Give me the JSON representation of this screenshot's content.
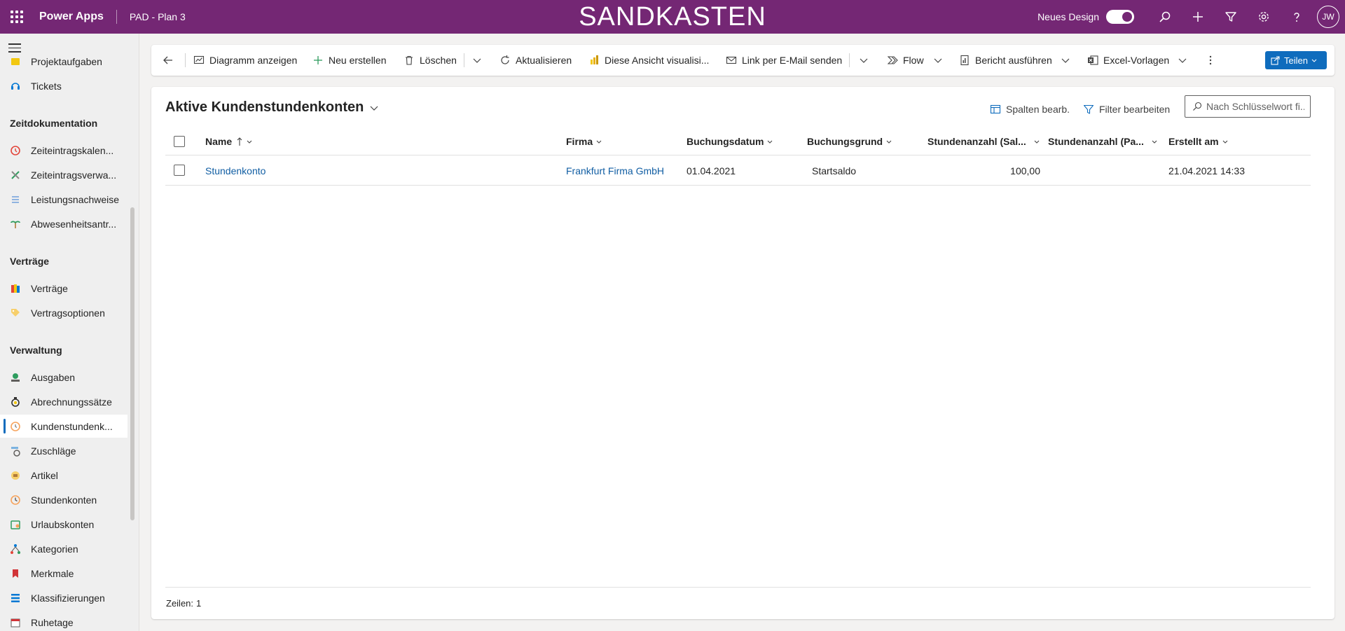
{
  "topbar": {
    "app_name": "Power Apps",
    "environment": "PAD - Plan 3",
    "banner": "SANDKASTEN",
    "new_design_label": "Neues Design",
    "new_design_on": true,
    "user_initials": "JW",
    "brand_color": "#742774",
    "icons": [
      "search-icon",
      "plus-icon",
      "filter-icon",
      "gear-icon",
      "help-icon"
    ]
  },
  "sidebar": {
    "items_top": [
      {
        "label": "Projektaufgaben",
        "icon": "task-icon"
      },
      {
        "label": "Tickets",
        "icon": "ticket-icon"
      }
    ],
    "groups": [
      {
        "title": "Zeitdokumentation",
        "items": [
          {
            "label": "Zeiteintragskalen...",
            "icon": "clock-icon"
          },
          {
            "label": "Zeiteintragsverwa...",
            "icon": "tools-icon"
          },
          {
            "label": "Leistungsnachweise",
            "icon": "list-icon"
          },
          {
            "label": "Abwesenheitsantr...",
            "icon": "palm-icon"
          }
        ]
      },
      {
        "title": "Verträge",
        "items": [
          {
            "label": "Verträge",
            "icon": "contract-icon"
          },
          {
            "label": "Vertragsoptionen",
            "icon": "tag-icon"
          }
        ]
      },
      {
        "title": "Verwaltung",
        "items": [
          {
            "label": "Ausgaben",
            "icon": "money-icon"
          },
          {
            "label": "Abrechnungssätze",
            "icon": "medal-icon"
          },
          {
            "label": "Kundenstundenk...",
            "icon": "customer-clock-icon",
            "active": true
          },
          {
            "label": "Zuschläge",
            "icon": "surcharge-icon"
          },
          {
            "label": "Artikel",
            "icon": "article-icon"
          },
          {
            "label": "Stundenkonten",
            "icon": "hours-icon"
          },
          {
            "label": "Urlaubskonten",
            "icon": "vacation-icon"
          },
          {
            "label": "Kategorien",
            "icon": "category-icon"
          },
          {
            "label": "Merkmale",
            "icon": "feature-icon"
          },
          {
            "label": "Klassifizierungen",
            "icon": "classification-icon"
          },
          {
            "label": "Ruhetage",
            "icon": "calendar-icon"
          }
        ]
      }
    ]
  },
  "commands": {
    "show_chart": "Diagramm anzeigen",
    "new": "Neu erstellen",
    "delete": "Löschen",
    "refresh": "Aktualisieren",
    "visualize": "Diese Ansicht visualisi...",
    "email_link": "Link per E-Mail senden",
    "flow": "Flow",
    "run_report": "Bericht ausführen",
    "excel_templates": "Excel-Vorlagen",
    "share": "Teilen"
  },
  "view": {
    "title": "Aktive Kundenstundenkonten",
    "edit_columns": "Spalten bearb.",
    "edit_filters": "Filter bearbeiten",
    "search_placeholder": "Nach Schlüsselwort fi..."
  },
  "grid": {
    "columns": [
      "Name",
      "Firma",
      "Buchungsdatum",
      "Buchungsgrund",
      "Stundenanzahl (Sal...",
      "Stundenanzahl (Pa...",
      "Erstellt am"
    ],
    "sort_column": "Name",
    "sort_direction": "ascending",
    "rows": [
      {
        "name": "Stundenkonto",
        "firma": "Frankfurt Firma GmbH",
        "buchungsdatum": "01.04.2021",
        "buchungsgrund": "Startsaldo",
        "stunden_saldo": "100,00",
        "stunden_pa": "",
        "erstellt_am": "21.04.2021 14:33"
      }
    ]
  },
  "footer": {
    "rows_label": "Zeilen:",
    "rows_count": "1"
  }
}
